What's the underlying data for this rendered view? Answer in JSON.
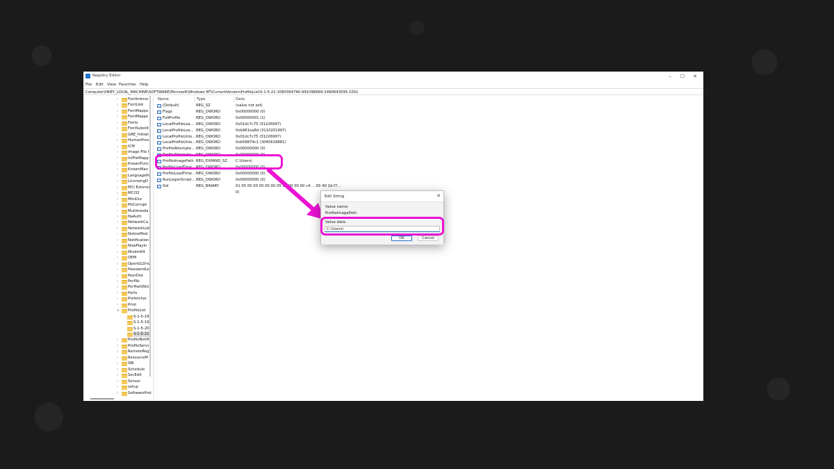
{
  "window": {
    "title": "Registry Editor",
    "controls": {
      "minimize": "–",
      "maximize": "☐",
      "close": "✕"
    }
  },
  "menu": [
    "File",
    "Edit",
    "View",
    "Favorites",
    "Help"
  ],
  "address": "Computer\\HKEY_LOCAL_MACHINE\\SOFTWARE\\Microsoft\\Windows NT\\CurrentVersion\\ProfileList\\S-1-5-21-1080364740-991098669-1490643595-1001",
  "tree": [
    "FontIntensi",
    "FontLink",
    "FontMappe",
    "FontMappe",
    "Fonts",
    "FontSubstit",
    "GRE_Initiali",
    "HumanPres",
    "ICM",
    "Image File I",
    "IniFileMapp",
    "KnownFunc",
    "KnownMan",
    "LanguagePa",
    "LicensingD",
    "MCI Extensi",
    "MCI32",
    "MiniDur",
    "MsCorrupt",
    "Multimedia",
    "NaAuth",
    "NetworkCa",
    "NetworkList",
    "NoImeMod",
    "Notification",
    "NowPlayin",
    "Ntvdm64",
    "OEM",
    "OpenGLDriv",
    "PasswordLe",
    "PeerDist",
    "Perflib",
    "PerHwIdSto",
    "Ports",
    "Prefetcher",
    "Print",
    "ProfileList"
  ],
  "tree_sub": [
    "S-1-5-18",
    "S-1-5-19",
    "S-1-5-20",
    "S-1-5-21"
  ],
  "tree_after": [
    "ProfileNotifi",
    "ProfileServi",
    "RemoteReg",
    "ResourceM",
    "SBI",
    "Schedule",
    "SecEdit",
    "Sensor",
    "setup",
    "SoftwareProt"
  ],
  "columns": {
    "name": "Name",
    "type": "Type",
    "data": "Data"
  },
  "rows": [
    {
      "name": "(Default)",
      "type": "REG_SZ",
      "data": "(value not set)"
    },
    {
      "name": "Flags",
      "type": "REG_DWORD",
      "data": "0x00000000 (0)"
    },
    {
      "name": "FullProfile",
      "type": "REG_DWORD",
      "data": "0x00000001 (1)"
    },
    {
      "name": "LocalProfileLoa...",
      "type": "REG_DWORD",
      "data": "0x01dc7c75 (31226997)"
    },
    {
      "name": "LocalProfileLoa...",
      "type": "REG_DWORD",
      "data": "0xb961ea8d (3110201997)"
    },
    {
      "name": "LocalProfileUnlo...",
      "type": "REG_DWORD",
      "data": "0x01dc7c75 (31226997)"
    },
    {
      "name": "LocalProfileUnlo...",
      "type": "REG_DWORD",
      "data": "0xb58874c1 (3045618881)"
    },
    {
      "name": "ProfileAttempte...",
      "type": "REG_DWORD",
      "data": "0x00000000 (0)"
    },
    {
      "name": "ProfileAttempte...",
      "type": "REG_DWORD",
      "data": "0x00000000 (0)"
    },
    {
      "name": "ProfileImagePath",
      "type": "REG_EXPAND_SZ",
      "data": "C:\\Users\\"
    },
    {
      "name": "ProfileLoadTime...",
      "type": "REG_DWORD",
      "data": "0x00000000 (0)"
    },
    {
      "name": "ProfileLoadTime...",
      "type": "REG_DWORD",
      "data": "0x00000000 (0)"
    },
    {
      "name": "RunLogonScript...",
      "type": "REG_DWORD",
      "data": "0x00000000 (0)"
    },
    {
      "name": "Sid",
      "type": "REG_BINARY",
      "data": "01 05 00 00 00 00 00 05 15 00 00 00 c4 ... 65 40 2d f7..."
    },
    {
      "name": "",
      "type": "",
      "data": "0)"
    }
  ],
  "dialog": {
    "title": "Edit String",
    "close": "✕",
    "value_name_label": "Value name:",
    "value_name": "ProfileImagePath",
    "value_data_label": "Value data:",
    "value_data": "C:\\Users\\",
    "ok": "OK",
    "cancel": "Cancel"
  },
  "colors": {
    "highlight": "#ec12d4",
    "folder": "#f4c95d",
    "accent": "#1f6fc9"
  }
}
